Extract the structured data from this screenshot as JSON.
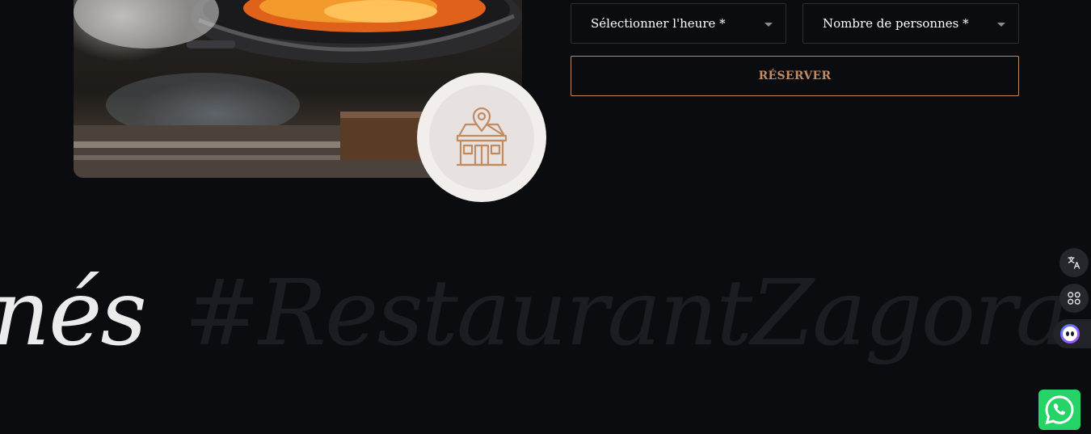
{
  "form": {
    "time_select": {
      "selected": "Sélectionner l'heure *"
    },
    "people_select": {
      "selected": "Nombre de personnes *"
    },
    "reserve_label": "RÉSERVER"
  },
  "marquee": {
    "left_fragment": "nés",
    "hashtag": "#RestaurantZagora"
  },
  "colors": {
    "background": "#0b0c10",
    "accent": "#c08a63",
    "badge_bg": "#f1eeec",
    "whatsapp_green": "#25d366"
  },
  "icons": {
    "badge": "restaurant-location-icon",
    "translate": "translate-icon",
    "apps": "apps-grid-icon",
    "assistant": "assistant-bot-icon",
    "whatsapp": "whatsapp-icon"
  }
}
